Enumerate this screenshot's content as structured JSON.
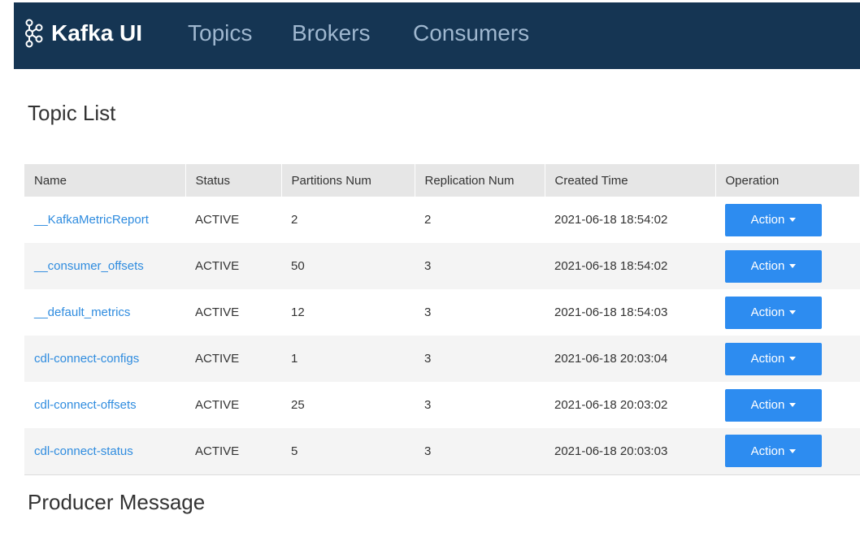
{
  "navbar": {
    "brand": "Kafka UI",
    "brand_icon": "kafka-logo-icon",
    "links": [
      {
        "label": "Topics"
      },
      {
        "label": "Brokers"
      },
      {
        "label": "Consumers"
      }
    ]
  },
  "topics_section": {
    "title": "Topic List",
    "columns": [
      "Name",
      "Status",
      "Partitions Num",
      "Replication Num",
      "Created Time",
      "Operation"
    ],
    "rows": [
      {
        "name": "__KafkaMetricReport",
        "status": "ACTIVE",
        "partitions": "2",
        "replication": "2",
        "created": "2021-06-18 18:54:02",
        "action": "Action"
      },
      {
        "name": "__consumer_offsets",
        "status": "ACTIVE",
        "partitions": "50",
        "replication": "3",
        "created": "2021-06-18 18:54:02",
        "action": "Action"
      },
      {
        "name": "__default_metrics",
        "status": "ACTIVE",
        "partitions": "12",
        "replication": "3",
        "created": "2021-06-18 18:54:03",
        "action": "Action"
      },
      {
        "name": "cdl-connect-configs",
        "status": "ACTIVE",
        "partitions": "1",
        "replication": "3",
        "created": "2021-06-18 20:03:04",
        "action": "Action"
      },
      {
        "name": "cdl-connect-offsets",
        "status": "ACTIVE",
        "partitions": "25",
        "replication": "3",
        "created": "2021-06-18 20:03:02",
        "action": "Action"
      },
      {
        "name": "cdl-connect-status",
        "status": "ACTIVE",
        "partitions": "5",
        "replication": "3",
        "created": "2021-06-18 20:03:03",
        "action": "Action"
      }
    ]
  },
  "producer_section": {
    "title": "Producer Message"
  },
  "colors": {
    "navbar_bg": "#153553",
    "nav_link": "#9fb7cf",
    "link": "#2f8cdf",
    "button": "#2d8cf0"
  }
}
